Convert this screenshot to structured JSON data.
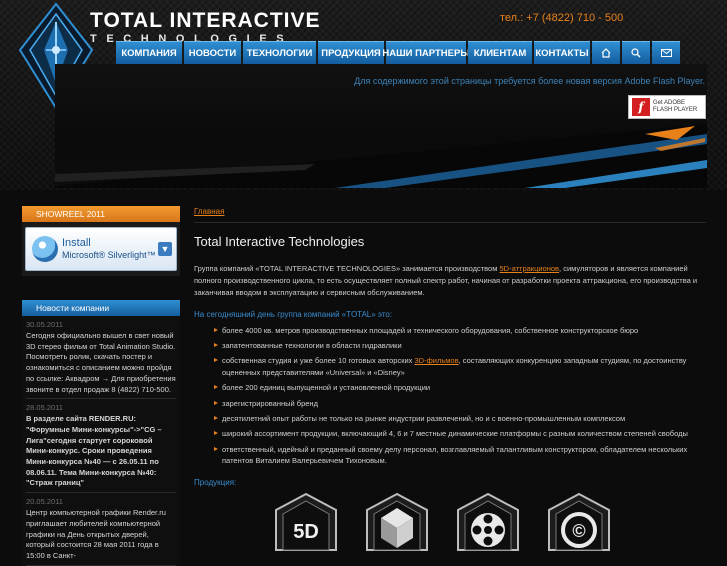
{
  "brand": {
    "name_top": "TOTAL INTERACTIVE",
    "name_bottom": "TECHNOLOGIES",
    "phone": "тел.: +7 (4822) 710 - 500"
  },
  "nav": {
    "items": [
      {
        "label": "КОМПАНИЯ"
      },
      {
        "label": "НОВОСТИ"
      },
      {
        "label": "ТЕХНОЛОГИИ"
      },
      {
        "label": "ПРОДУКЦИЯ"
      },
      {
        "label": "НАШИ ПАРТНЕРЫ"
      },
      {
        "label": "КЛИЕНТАМ"
      },
      {
        "label": "КОНТАКТЫ"
      }
    ],
    "icons": [
      "home-icon",
      "search-icon",
      "mail-icon"
    ]
  },
  "flash": {
    "notice": "Для содержимого этой страницы требуется более новая версия Adobe Flash Player.",
    "badge_line1": "Get ADOBE",
    "badge_line2": "FLASH PLAYER"
  },
  "sidebar": {
    "showreel_title": "SHOWREEL 2011",
    "silverlight_line1": "Install",
    "silverlight_line2": "Microsoft® Silverlight™",
    "news_title": "Новости компании",
    "news": [
      {
        "date": "30.05.2011",
        "text": "Сегодня официально вышел в свет новый 3D стерео фильм от Total Animation Studio. Посмотреть ролик, скачать постер и ознакомиться с описанием можно пройдя по ссылке: Аквадром → Для приобретения звоните в отдел продаж 8 (4822) 710-500."
      },
      {
        "date": "28.05.2011",
        "text": "В разделе сайта RENDER.RU: \"Форумные Мини-конкурсы\"->\"CG – Лига\"сегодня стартует сороковой Мини-конкурс. Сроки проведения Мини-конкурса №40 — с 26.05.11 по 08.06.11. Тема Мини-конкурса №40: \"Страж границ\""
      },
      {
        "date": "20.05.2011",
        "text": "Центр компьютерной графики Render.ru приглашает любителей компьютерной графики на День открытых дверей, который состоится 28 мая 2011 года в 15:00 в Санкт-"
      }
    ]
  },
  "main": {
    "breadcrumb": "Главная",
    "title": "Total Interactive Technologies",
    "intro_before": "Группа компаний «TOTAL INTERACTIVE TECHNOLOGIES» занимается производством ",
    "intro_link": "5D-аттракционов",
    "intro_after": ", симуляторов и является компанией полного производственного цикла, то есть осуществляет полный спектр работ, начиная от разработки проекта аттракциона, его производства и заканчивая вводом в эксплуатацию и сервисным обслуживанием.",
    "subhead": "На сегодняшний день группа компаний «TOTAL» это:",
    "bullets": [
      "более 4000 кв. метров производственных площадей и технического оборудования, собственное конструкторское бюро",
      "запатентованные технологии в области гидравлики",
      {
        "before": "собственная студия и уже более 10 готовых авторских ",
        "link": "3D-фильмов",
        "after": ", составляющих конкуренцию западным студиям, по достоинству оцененных представителями «Universal» и «Disney»"
      },
      "более 200 единиц выпущенной и установленной продукции",
      "зарегистрированный бренд",
      "десятилетний опыт работы не только на рынке индустрии развлечений, но и с военно-промышленным комплексом",
      "широкий ассортимент продукции, включающий 4, 6 и 7 местные динамические платформы с разным количеством степеней свободы",
      "ответственный, идейный и преданный своему делу персонал, возглавляемый талантливым конструктором, обладателем нескольких патентов Виталием Валерьевичем Тихоновым."
    ],
    "products_label": "Продукция:",
    "products": [
      {
        "icon": "5d-product-icon",
        "label": "5D"
      },
      {
        "icon": "simulator-product-icon",
        "label": ""
      },
      {
        "icon": "film-reel-product-icon",
        "label": ""
      },
      {
        "icon": "copyright-product-icon",
        "label": "©"
      }
    ]
  },
  "colors": {
    "accent_orange": "#e8811a",
    "nav_blue": "#2f8fd2",
    "link_blue": "#3a8ccf",
    "background": "#0c0c0c"
  }
}
